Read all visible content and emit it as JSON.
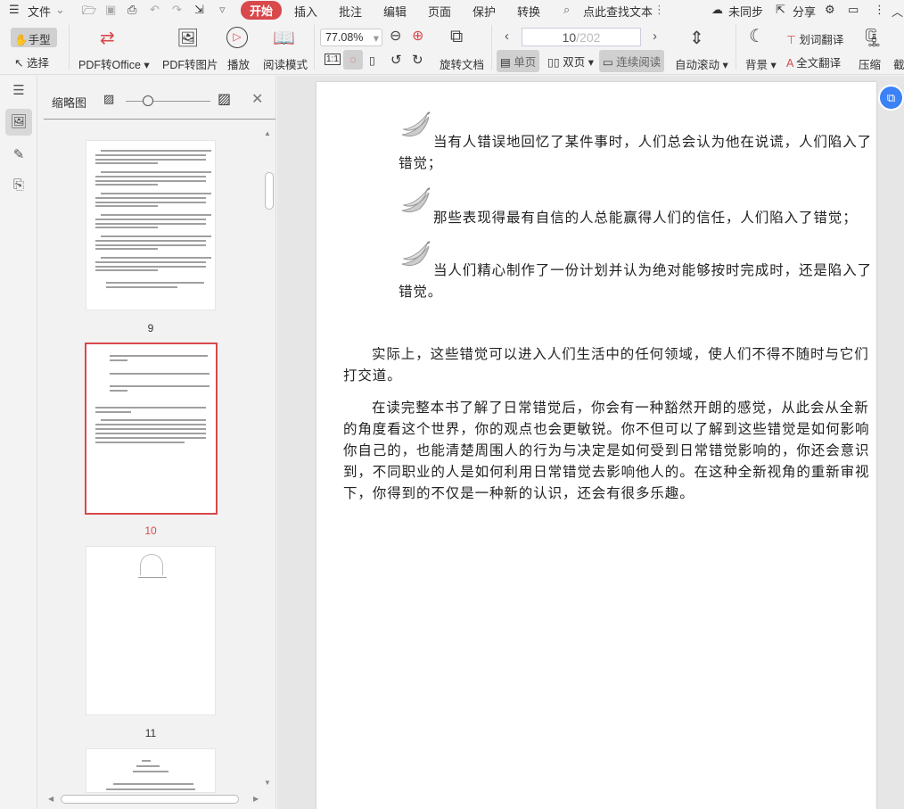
{
  "menubar": {
    "file": "文件",
    "tabs": [
      "开始",
      "插入",
      "批注",
      "编辑",
      "页面",
      "保护",
      "转换"
    ],
    "search": "点此查找文本",
    "sync": "未同步",
    "share": "分享"
  },
  "toolbar": {
    "hand": "手型",
    "select": "选择",
    "pdf_to_office": "PDF转Office",
    "pdf_to_image": "PDF转图片",
    "play": "播放",
    "read_mode": "阅读模式",
    "zoom": "77.08%",
    "rotate_doc": "旋转文档",
    "page_current": "10",
    "page_total": "/202",
    "single_page": "单页",
    "double_page": "双页",
    "continuous": "连续阅读",
    "auto_scroll": "自动滚动",
    "background": "背景",
    "word_translate": "划词翻译",
    "full_translate": "全文翻译",
    "compress": "压缩",
    "crop": "截"
  },
  "thumbnails": {
    "title": "缩略图",
    "pages": [
      {
        "label": "9"
      },
      {
        "label": "10"
      },
      {
        "label": "11"
      }
    ]
  },
  "document": {
    "bullets": [
      {
        "lines": [
          "当有人错误地回忆了某件事时，人们总会认为他在说谎，人们陷入了",
          "错觉；"
        ]
      },
      {
        "lines": [
          "那些表现得最有自信的人总能赢得人们的信任，人们陷入了错觉；"
        ]
      },
      {
        "lines": [
          "当人们精心制作了一份计划并认为绝对能够按时完成时，还是陷入了",
          "错觉。"
        ]
      }
    ],
    "paragraphs": [
      {
        "lines": [
          "实际上，这些错觉可以进入人们生活中的任何领域，使人们不得不随时与它们",
          "打交道。"
        ]
      },
      {
        "lines": [
          "在读完整本书了解了日常错觉后，你会有一种豁然开朗的感觉，从此会从全新",
          "的角度看这个世界，你的观点也会更敏锐。你不但可以了解到这些错觉是如何影响",
          "你自己的，也能清楚周围人的行为与决定是如何受到日常错觉影响的，你还会意识",
          "到，不同职业的人是如何利用日常错觉去影响他人的。在这种全新视角的重新审视",
          "下，你得到的不仅是一种新的认识，还会有很多乐趣。"
        ]
      }
    ]
  },
  "colors": {
    "accent": "#d9484b",
    "float_button": "#3b82f6"
  }
}
